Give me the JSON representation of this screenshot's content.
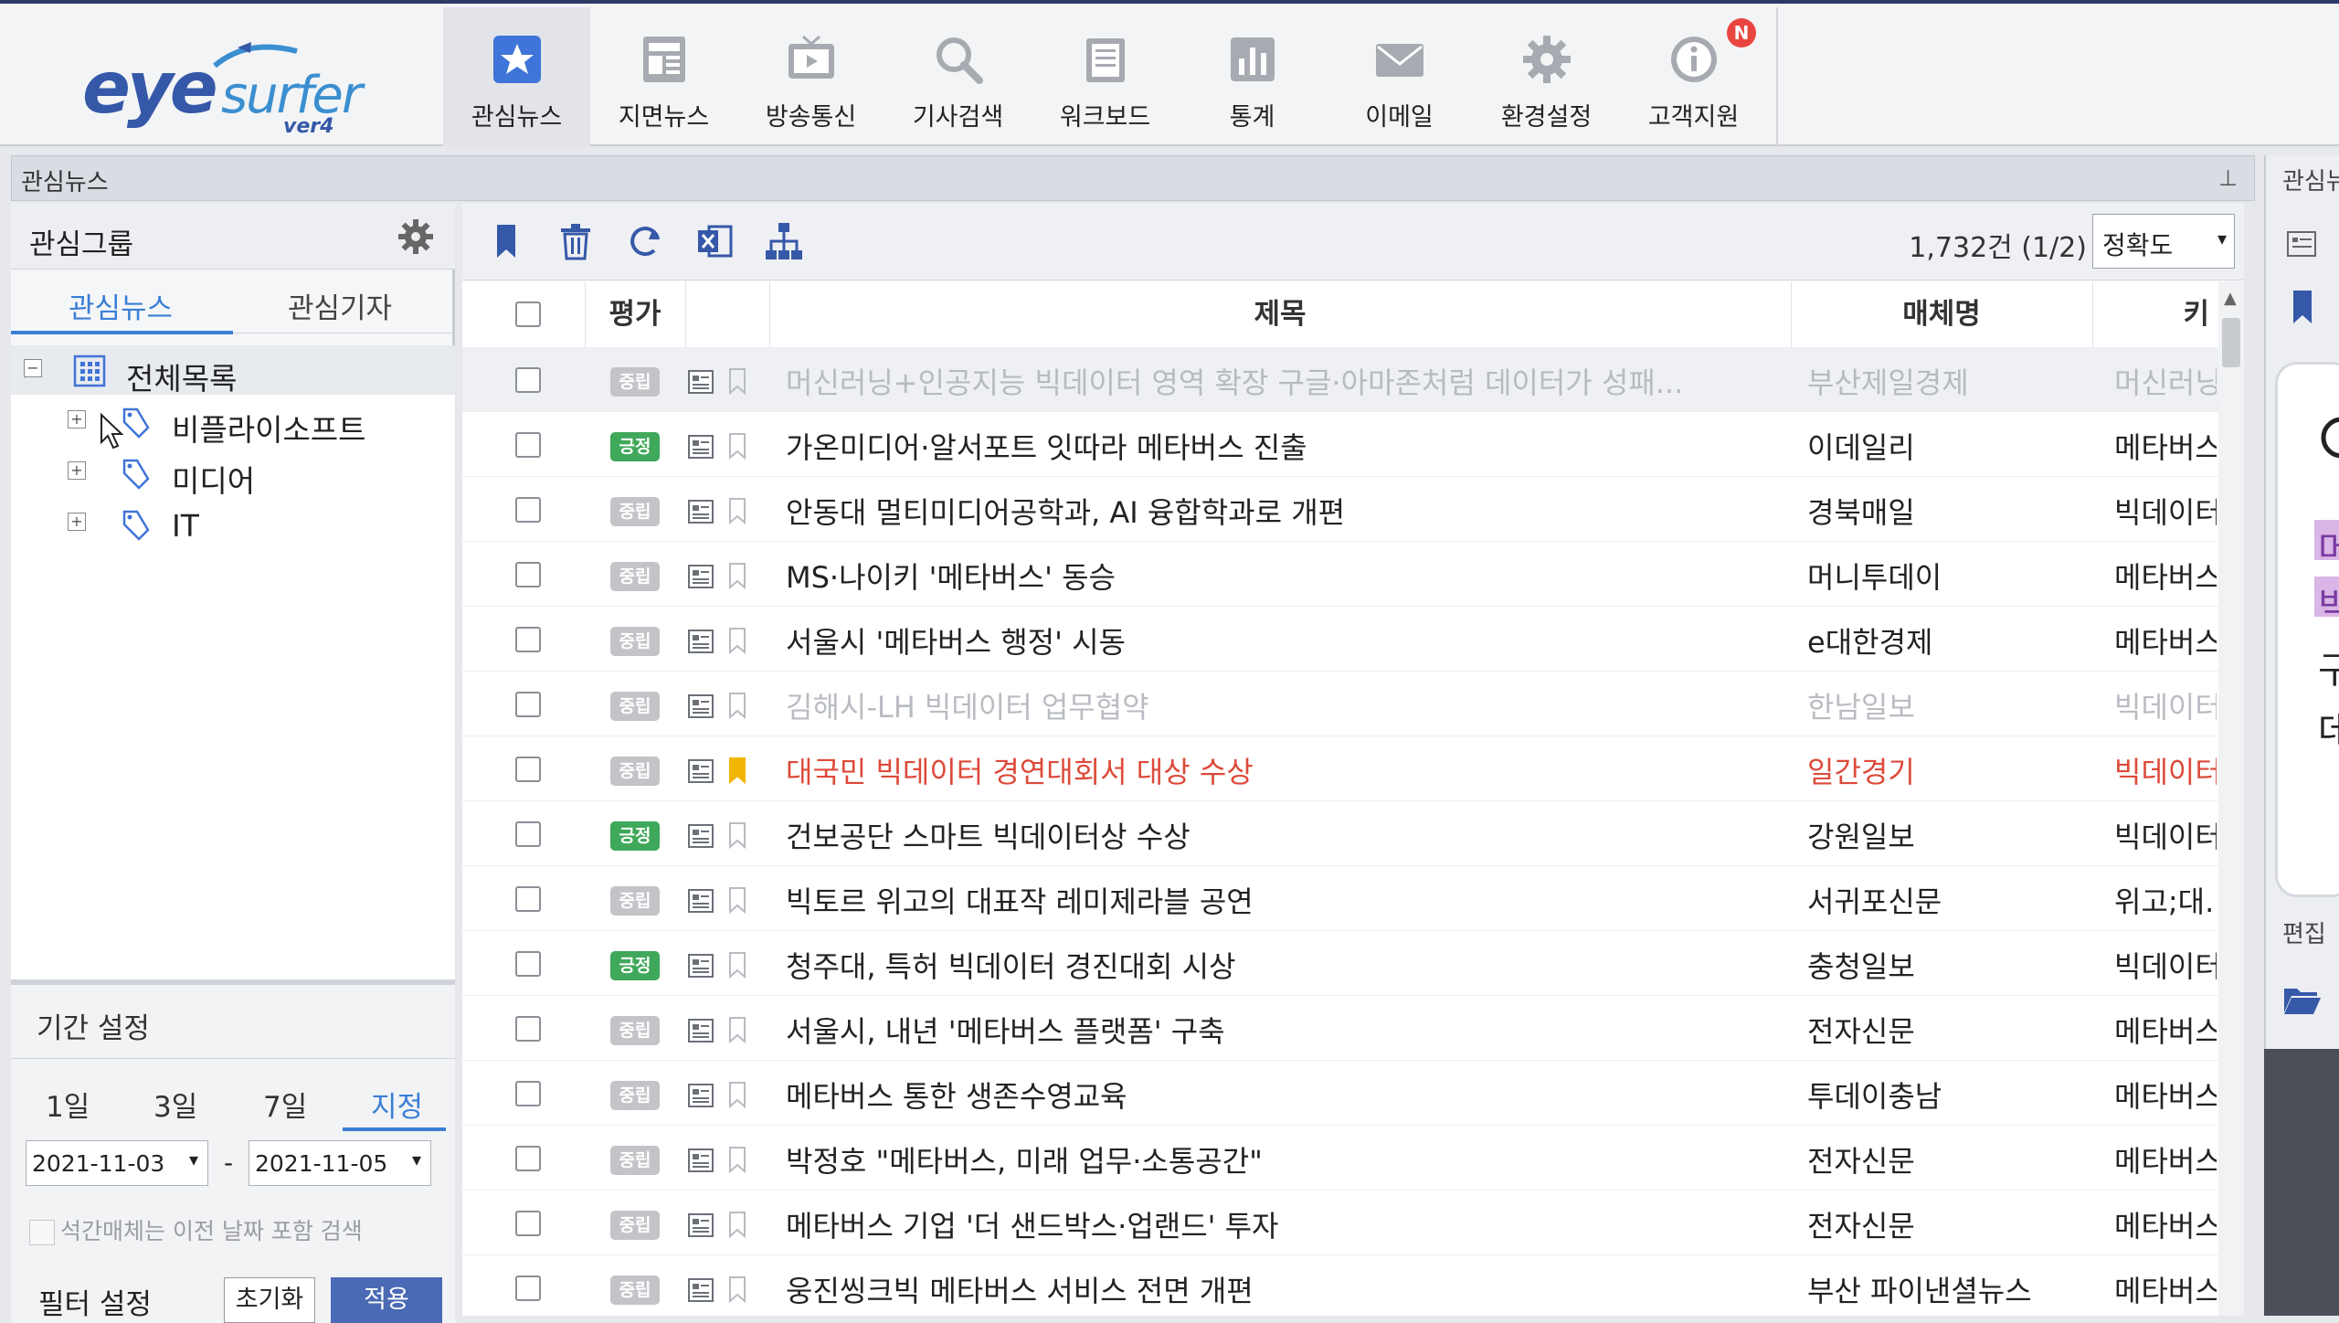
{
  "app": {
    "logo_main": "eye",
    "logo_sub": "surfer",
    "logo_ver": "ver4"
  },
  "nav": [
    {
      "label": "관심뉴스",
      "icon": "star-icon"
    },
    {
      "label": "지면뉴스",
      "icon": "newspaper-icon"
    },
    {
      "label": "방송통신",
      "icon": "tv-icon"
    },
    {
      "label": "기사검색",
      "icon": "search-icon"
    },
    {
      "label": "워크보드",
      "icon": "clipboard-icon"
    },
    {
      "label": "통계",
      "icon": "bar-chart-icon"
    },
    {
      "label": "이메일",
      "icon": "mail-icon"
    },
    {
      "label": "환경설정",
      "icon": "gear-icon"
    },
    {
      "label": "고객지원",
      "icon": "info-icon",
      "badge": "N"
    }
  ],
  "panel": {
    "title": "관심뉴스",
    "pin": "ㅁ"
  },
  "sidebar": {
    "group_title": "관심그룹",
    "tabs": [
      "관심뉴스",
      "관심기자"
    ],
    "tree": [
      {
        "label": "전체목록",
        "toggle": "−"
      },
      {
        "label": "비플라이소프트",
        "toggle": "+"
      },
      {
        "label": "미디어",
        "toggle": "+"
      },
      {
        "label": "IT",
        "toggle": "+"
      }
    ],
    "period_title": "기간 설정",
    "period_tabs": [
      "1일",
      "3일",
      "7일",
      "지정"
    ],
    "date_from": "2021-11-03",
    "date_to": "2021-11-05",
    "date_sep": "-",
    "include_prev_label": "석간매체는 이전 날짜 포함 검색",
    "filter_title": "필터 설정",
    "reset_label": "초기화",
    "apply_label": "적용"
  },
  "toolbar": {
    "count": "1,732건 (1/2)",
    "sort_selected": "정확도"
  },
  "table": {
    "headers": {
      "eval": "평가",
      "title": "제목",
      "media": "매체명",
      "keyword": "키"
    },
    "rows": [
      {
        "eval": "중립",
        "tone": "neu",
        "title": "머신러닝+인공지능 빅데이터 영역 확장 구글·아마존처럼 데이터가 성패...",
        "media": "부산제일경제",
        "keyword": "머신러닝",
        "style": "dim",
        "bookmark": false
      },
      {
        "eval": "긍정",
        "tone": "pos",
        "title": "가온미디어·알서포트 잇따라 메타버스 진출",
        "media": "이데일리",
        "keyword": "메타버스",
        "style": "",
        "bookmark": false
      },
      {
        "eval": "중립",
        "tone": "neu",
        "title": "안동대 멀티미디어공학과, AI 융합학과로 개편",
        "media": "경북매일",
        "keyword": "빅데이터",
        "style": "",
        "bookmark": false
      },
      {
        "eval": "중립",
        "tone": "neu",
        "title": "MS·나이키 '메타버스' 동승",
        "media": "머니투데이",
        "keyword": "메타버스",
        "style": "",
        "bookmark": false
      },
      {
        "eval": "중립",
        "tone": "neu",
        "title": "서울시 '메타버스 행정' 시동",
        "media": "e대한경제",
        "keyword": "메타버스",
        "style": "",
        "bookmark": false
      },
      {
        "eval": "중립",
        "tone": "neu",
        "title": "김해시-LH 빅데이터 업무협약",
        "media": "한남일보",
        "keyword": "빅데이터",
        "style": "fade",
        "bookmark": false
      },
      {
        "eval": "중립",
        "tone": "neu",
        "title": "대국민 빅데이터 경연대회서 대상 수상",
        "media": "일간경기",
        "keyword": "빅데이터",
        "style": "red",
        "bookmark": true
      },
      {
        "eval": "긍정",
        "tone": "pos",
        "title": "건보공단 스마트 빅데이터상 수상",
        "media": "강원일보",
        "keyword": "빅데이터",
        "style": "",
        "bookmark": false
      },
      {
        "eval": "중립",
        "tone": "neu",
        "title": "빅토르 위고의 대표작 레미제라블 공연",
        "media": "서귀포신문",
        "keyword": "위고;대...",
        "style": "",
        "bookmark": false
      },
      {
        "eval": "긍정",
        "tone": "pos",
        "title": "청주대, 특허 빅데이터 경진대회 시상",
        "media": "충청일보",
        "keyword": "빅데이터",
        "style": "",
        "bookmark": false
      },
      {
        "eval": "중립",
        "tone": "neu",
        "title": "서울시, 내년 '메타버스 플랫폼' 구축",
        "media": "전자신문",
        "keyword": "메타버스",
        "style": "",
        "bookmark": false
      },
      {
        "eval": "중립",
        "tone": "neu",
        "title": "메타버스 통한 생존수영교육",
        "media": "투데이충남",
        "keyword": "메타버스",
        "style": "",
        "bookmark": false
      },
      {
        "eval": "중립",
        "tone": "neu",
        "title": "박정호 \"메타버스, 미래 업무·소통공간\"",
        "media": "전자신문",
        "keyword": "메타버스",
        "style": "",
        "bookmark": false
      },
      {
        "eval": "중립",
        "tone": "neu",
        "title": "메타버스 기업 '더 샌드박스·업랜드' 투자",
        "media": "전자신문",
        "keyword": "메타버스",
        "style": "",
        "bookmark": false
      },
      {
        "eval": "중립",
        "tone": "neu",
        "title": "웅진씽크빅 메타버스 서비스 전면 개편",
        "media": "부산 파이낸셜뉴스",
        "keyword": "메타버스",
        "style": "",
        "bookmark": false
      }
    ]
  },
  "right_panel": {
    "title": "관심뉴스",
    "title2": "편집",
    "chars": [
      "머",
      "빅",
      "구",
      "데"
    ]
  },
  "colors": {
    "accent": "#3a7fd5",
    "positive": "#3fa85a",
    "neutral": "#c2c4c8",
    "highlight_red": "#dd4a3a",
    "apply_btn": "#4a6ab5"
  }
}
